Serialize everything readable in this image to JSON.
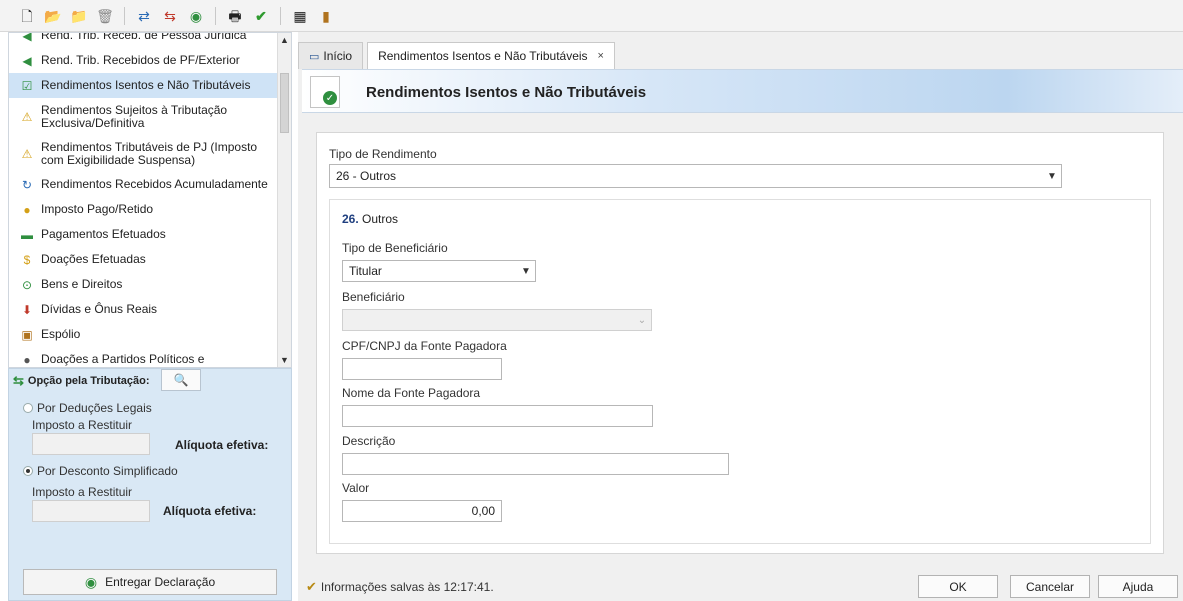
{
  "toolbar": {
    "icons": [
      "new-file-icon",
      "open-folder-icon",
      "folder-icon",
      "trash-icon",
      "import-icon",
      "export-icon",
      "transmit-icon",
      "print-icon",
      "check-icon",
      "calculator-icon",
      "book-icon"
    ]
  },
  "sidebar": {
    "items": [
      {
        "label": "Rend. Trib. Receb. de Pessoa Jurídica",
        "icon": "money-arrow-icon"
      },
      {
        "label": "Rend. Trib. Recebidos de PF/Exterior",
        "icon": "money-arrow-icon"
      },
      {
        "label": "Rendimentos Isentos e Não Tributáveis",
        "icon": "document-check-icon"
      },
      {
        "label": "Rendimentos Sujeitos à Tributação Exclusiva/Definitiva",
        "icon": "document-warning-icon"
      },
      {
        "label": "Rendimentos Tributáveis de PJ (Imposto com Exigibilidade Suspensa)",
        "icon": "money-warning-icon"
      },
      {
        "label": "Rendimentos Recebidos Acumuladamente",
        "icon": "document-refresh-icon"
      },
      {
        "label": "Imposto Pago/Retido",
        "icon": "coin-hand-icon"
      },
      {
        "label": "Pagamentos Efetuados",
        "icon": "card-icon"
      },
      {
        "label": "Doações Efetuadas",
        "icon": "donation-icon"
      },
      {
        "label": "Bens e Direitos",
        "icon": "assets-icon"
      },
      {
        "label": "Dívidas e Ônus Reais",
        "icon": "debt-arrow-icon"
      },
      {
        "label": "Espólio",
        "icon": "chest-icon"
      },
      {
        "label": "Doações a Partidos Políticos e",
        "icon": "party-icon"
      }
    ]
  },
  "tributacao": {
    "title": "Opção pela Tributação:",
    "option1": "Por Deduções Legais",
    "option1_checked": false,
    "imposto_label1": "Imposto a Restituir",
    "aliquota_label1": "Alíquota efetiva:",
    "option2": "Por Desconto Simplificado",
    "option2_checked": true,
    "imposto_label2": "Imposto a Restituir",
    "aliquota_label2": "Alíquota efetiva:",
    "entregar_label": "Entregar Declaração"
  },
  "tabs": [
    {
      "label": "Início"
    },
    {
      "label": "Rendimentos Isentos e Não Tributáveis"
    }
  ],
  "tab_close": "×",
  "header": {
    "title": "Rendimentos Isentos e Não Tributáveis"
  },
  "form": {
    "tipo_rendimento_label": "Tipo de Rendimento",
    "tipo_rendimento_value": "26 - Outros",
    "section_number": "26.",
    "section_name": "Outros",
    "tipo_beneficiario_label": "Tipo de Beneficiário",
    "tipo_beneficiario_value": "Titular",
    "beneficiario_label": "Beneficiário",
    "beneficiario_value": "",
    "cpf_label": "CPF/CNPJ da Fonte Pagadora",
    "cpf_value": "",
    "nome_label": "Nome da Fonte Pagadora",
    "nome_value": "",
    "descricao_label": "Descrição",
    "descricao_value": "",
    "valor_label": "Valor",
    "valor_value": "0,00"
  },
  "status": {
    "info": "Informações salvas às 12:17:41."
  },
  "buttons": {
    "ok": "OK",
    "cancelar": "Cancelar",
    "ajuda": "Ajuda"
  },
  "colors": {
    "selected_row": "#cfe3f6",
    "panel_bg": "#d9e8f5",
    "accent_green": "#2f8f3f"
  }
}
